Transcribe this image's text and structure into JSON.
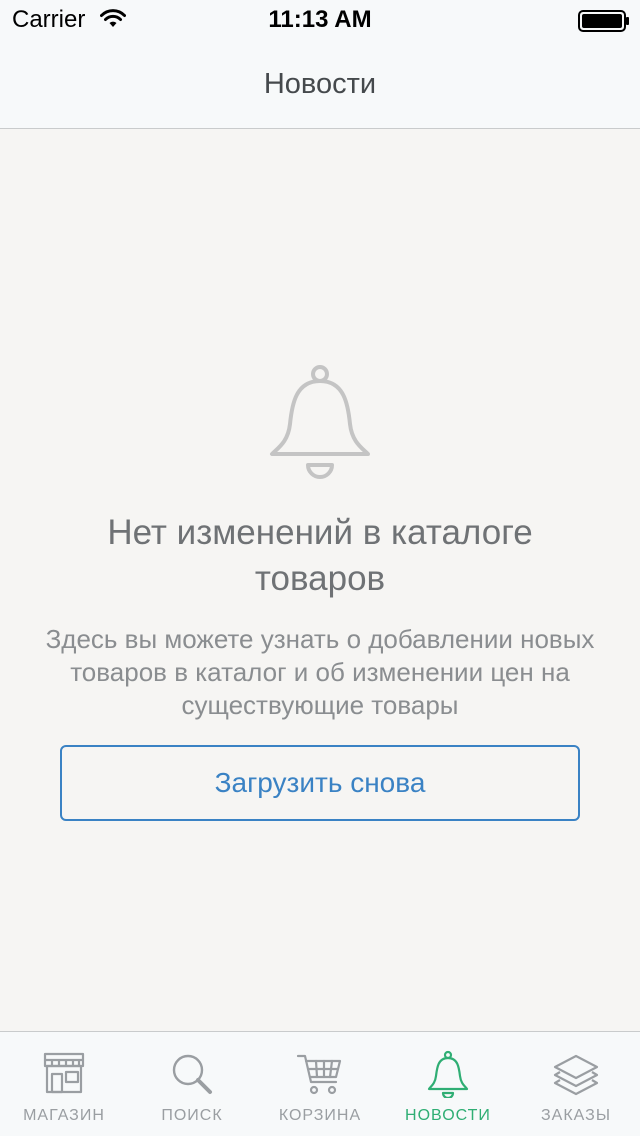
{
  "status_bar": {
    "carrier": "Carrier",
    "time": "11:13 AM"
  },
  "nav": {
    "title": "Новости"
  },
  "empty_state": {
    "icon": "bell-icon",
    "title": "Нет изменений в каталоге товаров",
    "description": "Здесь вы можете узнать о добавлении новых товаров в каталог и об изменении цен на существующие товары",
    "reload_label": "Загрузить снова"
  },
  "tab_bar": {
    "active_color": "#2fae74",
    "inactive_color": "#9a9ea2",
    "items": [
      {
        "label": "МАГАЗИН",
        "icon": "store-icon",
        "active": false
      },
      {
        "label": "ПОИСК",
        "icon": "search-icon",
        "active": false
      },
      {
        "label": "КОРЗИНА",
        "icon": "cart-icon",
        "active": false
      },
      {
        "label": "НОВОСТИ",
        "icon": "bell-icon",
        "active": true
      },
      {
        "label": "ЗАКАЗЫ",
        "icon": "layers-icon",
        "active": false
      }
    ]
  }
}
